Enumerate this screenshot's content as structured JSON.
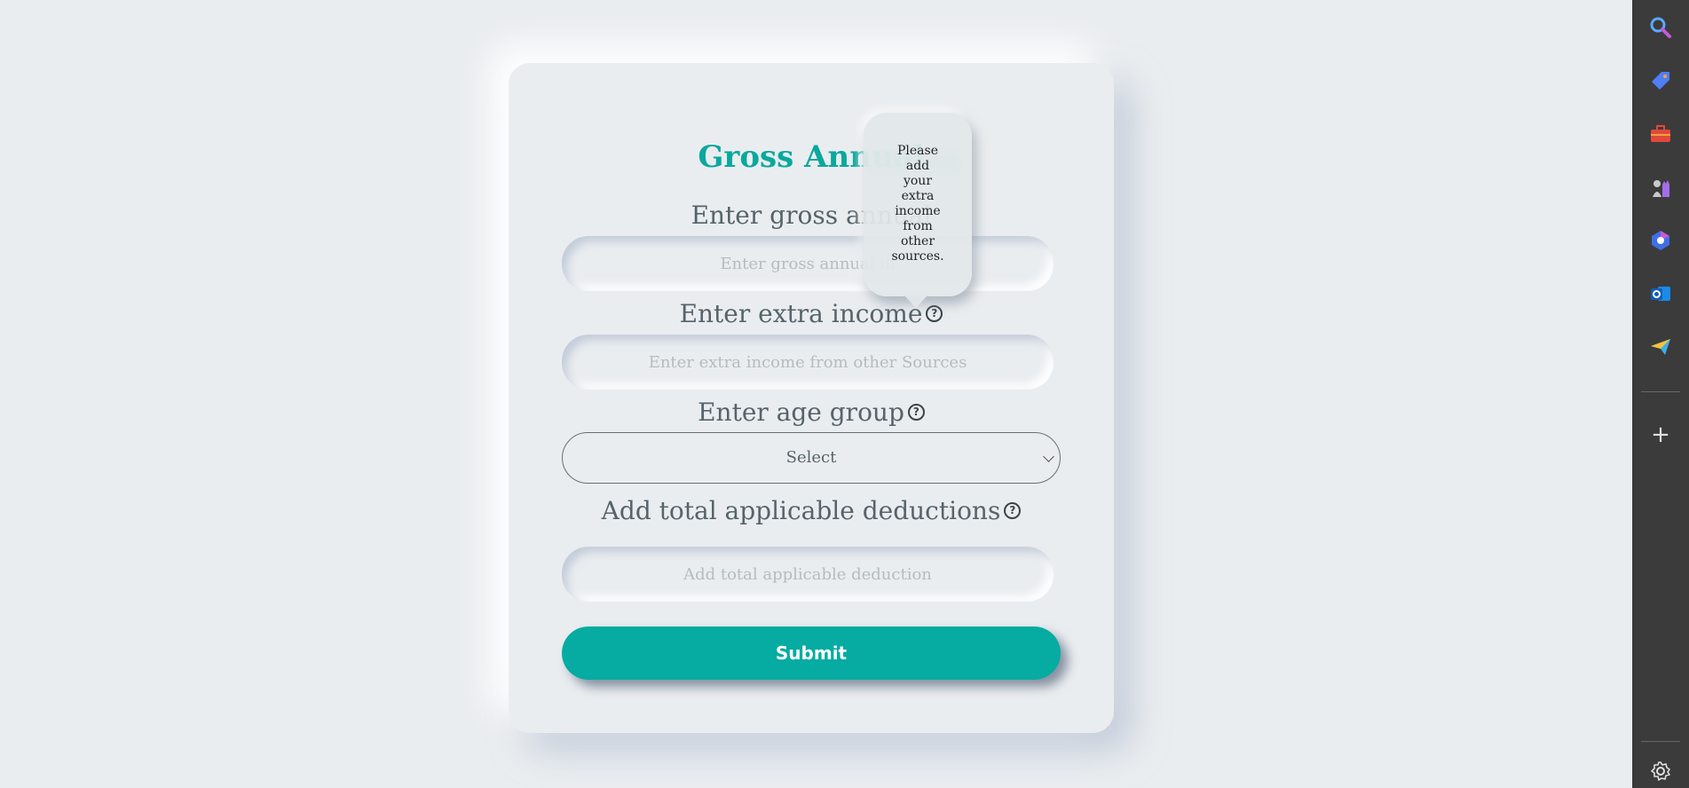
{
  "form": {
    "title": "Gross Annual",
    "gross_label": "Enter gross annual",
    "gross_placeholder": "Enter gross annual in",
    "extra_label": "Enter extra income",
    "extra_placeholder": "Enter extra income from other Sources",
    "age_label": "Enter age group",
    "age_selected": "Select",
    "deductions_label": "Add total applicable deductions",
    "deductions_placeholder": "Add total applicable deduction",
    "submit_label": "Submit",
    "help_glyph": "?"
  },
  "tooltip": {
    "words": [
      "Please",
      "add",
      "your",
      "extra",
      "income",
      "from",
      "other",
      "sources."
    ]
  },
  "sidebar": {
    "items": [
      "search-icon",
      "tag-icon",
      "toolbox-icon",
      "chess-icon",
      "copilot-icon",
      "outlook-icon",
      "send-icon"
    ],
    "add_glyph": "+",
    "settings": "gear-icon"
  },
  "colors": {
    "accent": "#06aba2",
    "title": "#0aa89e",
    "background": "#eaedf0",
    "sidebar": "#3b3b3b"
  }
}
